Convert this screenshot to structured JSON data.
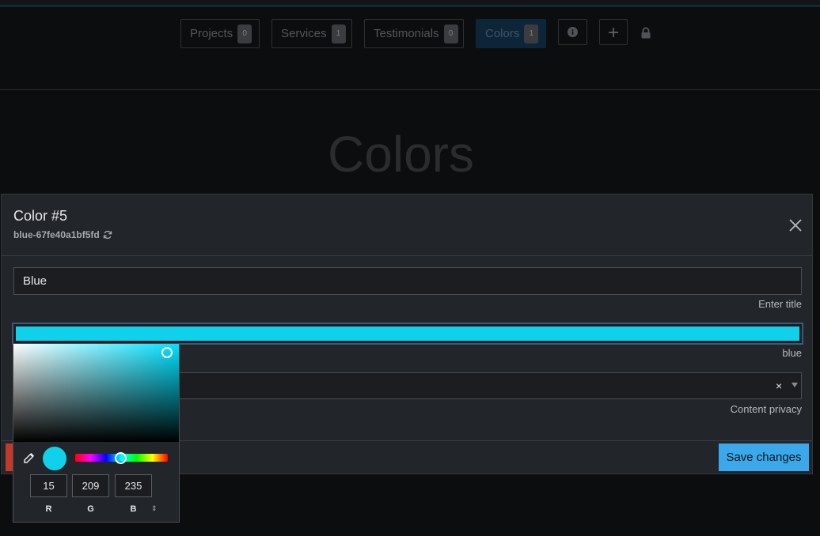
{
  "nav": {
    "items": [
      {
        "label": "Projects",
        "count": "0"
      },
      {
        "label": "Services",
        "count": "1"
      },
      {
        "label": "Testimonials",
        "count": "0"
      },
      {
        "label": "Colors",
        "count": "1"
      }
    ],
    "icons": [
      "info-icon",
      "plus-icon",
      "lock-icon"
    ]
  },
  "page": {
    "title": "Colors"
  },
  "modal": {
    "title": "Color #5",
    "slug": "blue-67fe40a1bf5fd",
    "title_value": "Blue",
    "title_helper": "Enter title",
    "color_value": "#0fd1eb",
    "color_helper": "blue",
    "privacy_helper": "Content privacy",
    "select_clear": "×",
    "save_label": "Save changes"
  },
  "picker": {
    "r": "15",
    "g": "209",
    "b": "235",
    "r_label": "R",
    "g_label": "G",
    "b_label": "B",
    "toggle": "⇕",
    "hue_base": "#00e1ff"
  },
  "colors": {
    "accent": "#3aa8ea",
    "danger": "#c0392b"
  }
}
